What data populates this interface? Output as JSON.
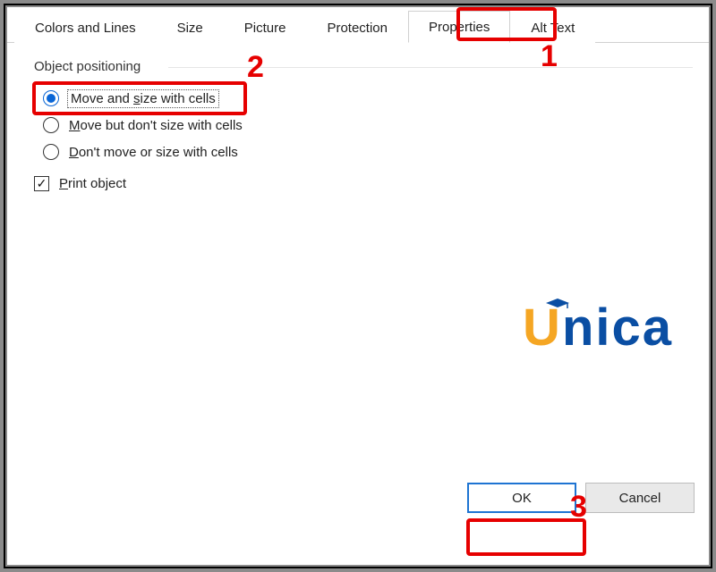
{
  "tabs": {
    "colors": "Colors and Lines",
    "size": "Size",
    "picture": "Picture",
    "protection": "Protection",
    "properties": "Properties",
    "alttext": "Alt Text",
    "active": "properties"
  },
  "group": {
    "title": "Object positioning"
  },
  "options": {
    "move_size": {
      "pre": "Move and ",
      "u": "s",
      "post": "ize with cells",
      "selected": true
    },
    "move_only": {
      "u": "M",
      "post": "ove but don't size with cells",
      "selected": false
    },
    "dont_move": {
      "u": "D",
      "post": "on't move or size with cells",
      "selected": false
    }
  },
  "print": {
    "u": "P",
    "post": "rint object",
    "checked": true
  },
  "buttons": {
    "ok": "OK",
    "cancel": "Cancel"
  },
  "annotations": {
    "n1": "1",
    "n2": "2",
    "n3": "3"
  },
  "logo": {
    "u": "U",
    "rest": "nica"
  }
}
